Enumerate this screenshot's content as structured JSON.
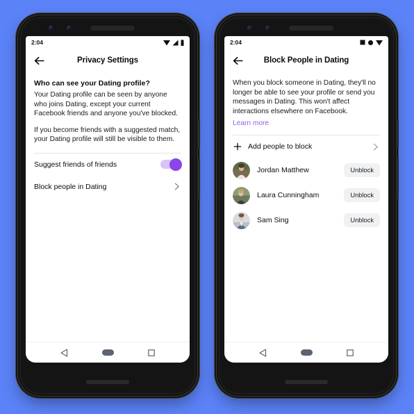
{
  "background_color": "#5b82f7",
  "accent_color": "#8b45e8",
  "link_color": "#9360e8",
  "phones": [
    {
      "id": "privacy-settings",
      "status_bar": {
        "time": "2:04",
        "icons": [
          "wifi-icon",
          "signal-icon",
          "battery-icon"
        ]
      },
      "appbar": {
        "back_label": "back-arrow-icon",
        "title": "Privacy Settings"
      },
      "section_heading": "Who can see your Dating profile?",
      "paragraph_1": "Your Dating profile can be seen by anyone who joins Dating, except your current Facebook friends and anyone you've blocked.",
      "paragraph_2": "If you become friends with a suggested match, your Dating profile will still be visible to them.",
      "rows": [
        {
          "label": "Suggest friends of friends",
          "control": "toggle",
          "toggle_on": true
        },
        {
          "label": "Block people in Dating",
          "control": "chevron"
        }
      ],
      "navbar": [
        "back-triangle-icon",
        "home-pill-icon",
        "recents-square-icon"
      ]
    },
    {
      "id": "block-people-in-dating",
      "status_bar": {
        "time": "2:04",
        "icons": [
          "square-icon",
          "circle-icon",
          "triangle-icon"
        ]
      },
      "appbar": {
        "back_label": "back-arrow-icon",
        "title": "Block People in Dating"
      },
      "paragraph_1": "When you block someone in Dating, they'll no longer be able to see your profile or send you messages in Dating. This won't affect interactions elsewhere on Facebook.",
      "learn_more": "Learn more",
      "add_row": {
        "label": "Add people to block",
        "icon": "plus-icon",
        "chevron": "chevron-right-icon"
      },
      "people": [
        {
          "name": "Jordan Matthew",
          "action": "Unblock"
        },
        {
          "name": "Laura Cunningham",
          "action": "Unblock"
        },
        {
          "name": "Sam Sing",
          "action": "Unblock"
        }
      ],
      "navbar": [
        "back-triangle-icon",
        "home-pill-icon",
        "recents-square-icon"
      ]
    }
  ]
}
